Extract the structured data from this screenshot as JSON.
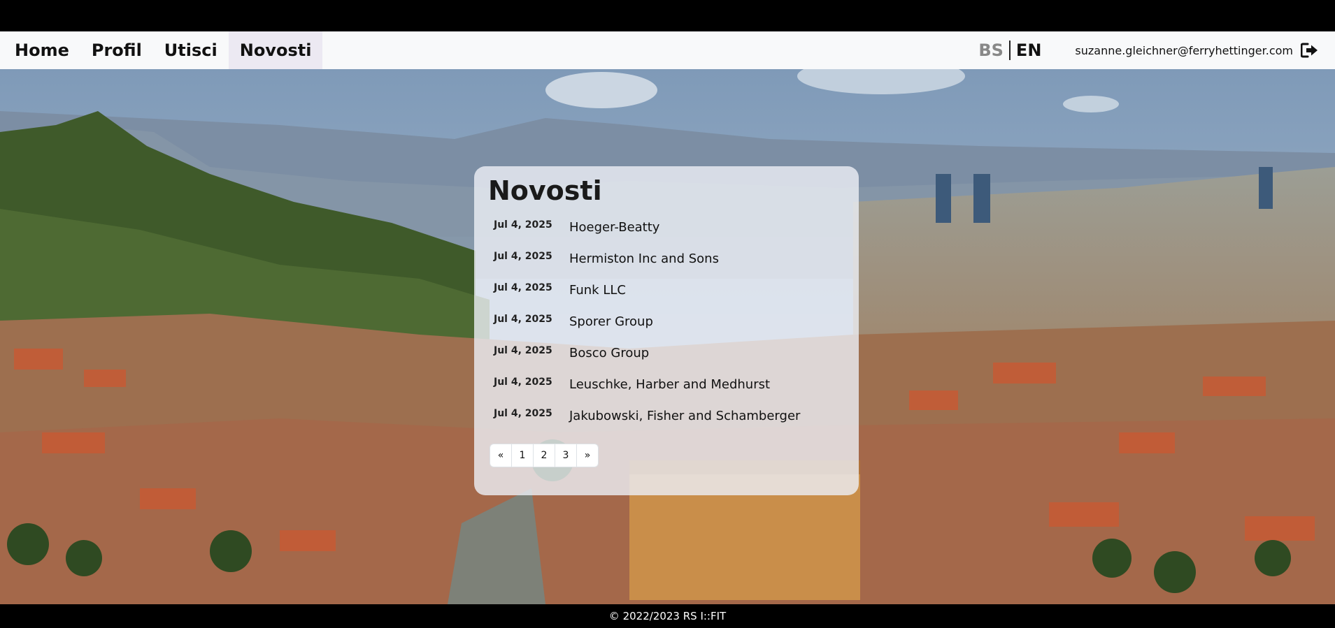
{
  "nav": {
    "links": [
      {
        "label": "Home"
      },
      {
        "label": "Profil"
      },
      {
        "label": "Utisci"
      },
      {
        "label": "Novosti"
      }
    ],
    "active": "Novosti",
    "lang_bs": "BS",
    "lang_en": "EN",
    "user_email": "suzanne.gleichner@ferryhettinger.com",
    "logout_icon": "sign-out-icon"
  },
  "news": {
    "title": "Novosti",
    "items": [
      {
        "date": "Jul 4, 2025",
        "title": "Hoeger-Beatty"
      },
      {
        "date": "Jul 4, 2025",
        "title": "Hermiston Inc and Sons"
      },
      {
        "date": "Jul 4, 2025",
        "title": "Funk LLC"
      },
      {
        "date": "Jul 4, 2025",
        "title": "Sporer Group"
      },
      {
        "date": "Jul 4, 2025",
        "title": "Bosco Group"
      },
      {
        "date": "Jul 4, 2025",
        "title": "Leuschke, Harber and Medhurst"
      },
      {
        "date": "Jul 4, 2025",
        "title": "Jakubowski, Fisher and Schamberger"
      }
    ]
  },
  "pagination": {
    "prev": "«",
    "pages": [
      "1",
      "2",
      "3"
    ],
    "next": "»"
  },
  "footer": {
    "text": "© 2022/2023 RS I::FIT"
  }
}
